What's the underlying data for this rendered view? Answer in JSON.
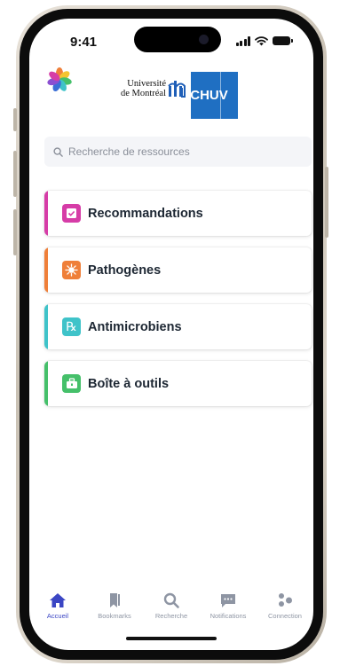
{
  "status": {
    "time": "9:41"
  },
  "header": {
    "udem_line1": "Université",
    "udem_line2": "de Montréal",
    "chuv": "CHUV"
  },
  "search": {
    "placeholder": "Recherche de ressources"
  },
  "menu": [
    {
      "label": "Recommandations",
      "color": "#d63ca7",
      "icon": "checkbox-icon"
    },
    {
      "label": "Pathogènes",
      "color": "#ef7f39",
      "icon": "virus-icon"
    },
    {
      "label": "Antimicrobiens",
      "color": "#3fc3c9",
      "icon": "prescription-icon"
    },
    {
      "label": "Boîte à outils",
      "color": "#45c06a",
      "icon": "toolbox-icon"
    }
  ],
  "tabs": [
    {
      "label": "Accueil",
      "icon": "home-icon",
      "active": true
    },
    {
      "label": "Bookmarks",
      "icon": "bookmark-icon"
    },
    {
      "label": "Recherche",
      "icon": "search-icon"
    },
    {
      "label": "Notifications",
      "icon": "notification-icon"
    },
    {
      "label": "Connection",
      "icon": "people-icon"
    }
  ],
  "colors": {
    "accent": "#3b46c4",
    "inactive": "#8e95a3",
    "chuv_blue": "#1f6fc2"
  }
}
